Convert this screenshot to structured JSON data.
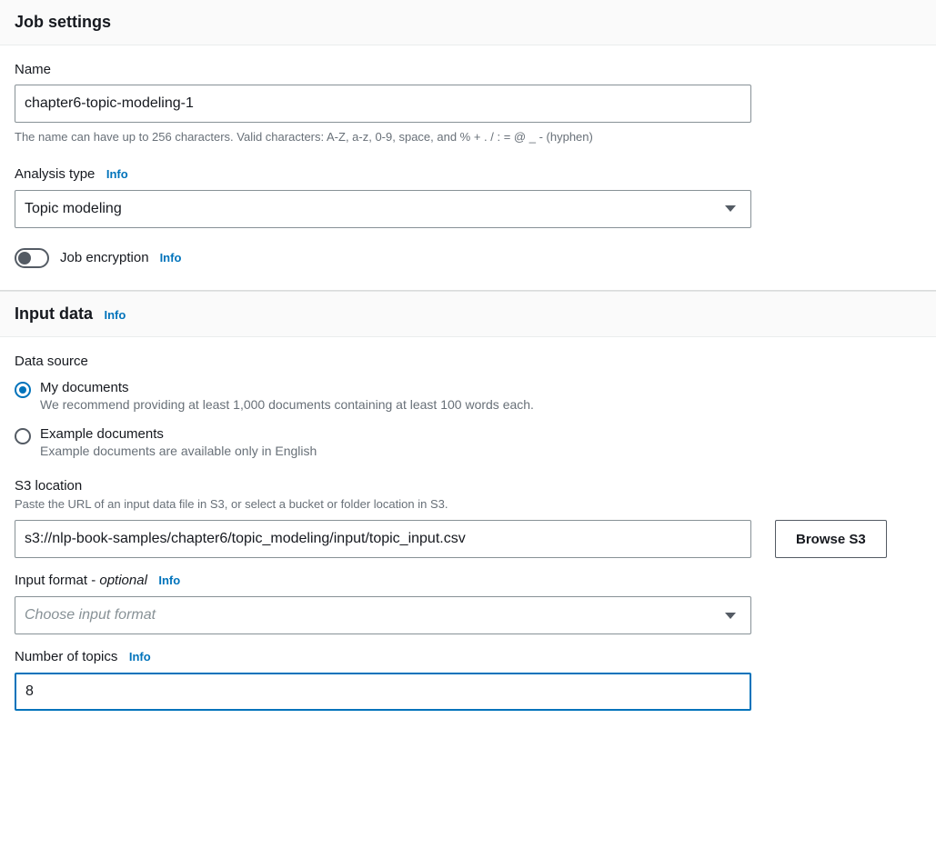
{
  "job_settings": {
    "title": "Job settings",
    "name": {
      "label": "Name",
      "value": "chapter6-topic-modeling-1",
      "helper": "The name can have up to 256 characters. Valid characters: A-Z, a-z, 0-9, space, and % + . / : = @ _ - (hyphen)"
    },
    "analysis_type": {
      "label": "Analysis type",
      "info": "Info",
      "selected": "Topic modeling"
    },
    "job_encryption": {
      "label": "Job encryption",
      "info": "Info",
      "enabled": false
    }
  },
  "input_data": {
    "title": "Input data",
    "info": "Info",
    "data_source": {
      "label": "Data source",
      "options": [
        {
          "primary": "My documents",
          "secondary": "We recommend providing at least 1,000 documents containing at least 100 words each.",
          "selected": true
        },
        {
          "primary": "Example documents",
          "secondary": "Example documents are available only in English",
          "selected": false
        }
      ]
    },
    "s3_location": {
      "label": "S3 location",
      "helper": "Paste the URL of an input data file in S3, or select a bucket or folder location in S3.",
      "value": "s3://nlp-book-samples/chapter6/topic_modeling/input/topic_input.csv",
      "browse_button": "Browse S3"
    },
    "input_format": {
      "label_main": "Input format - ",
      "label_optional": "optional",
      "info": "Info",
      "placeholder": "Choose input format"
    },
    "num_topics": {
      "label": "Number of topics",
      "info": "Info",
      "value": "8"
    }
  }
}
